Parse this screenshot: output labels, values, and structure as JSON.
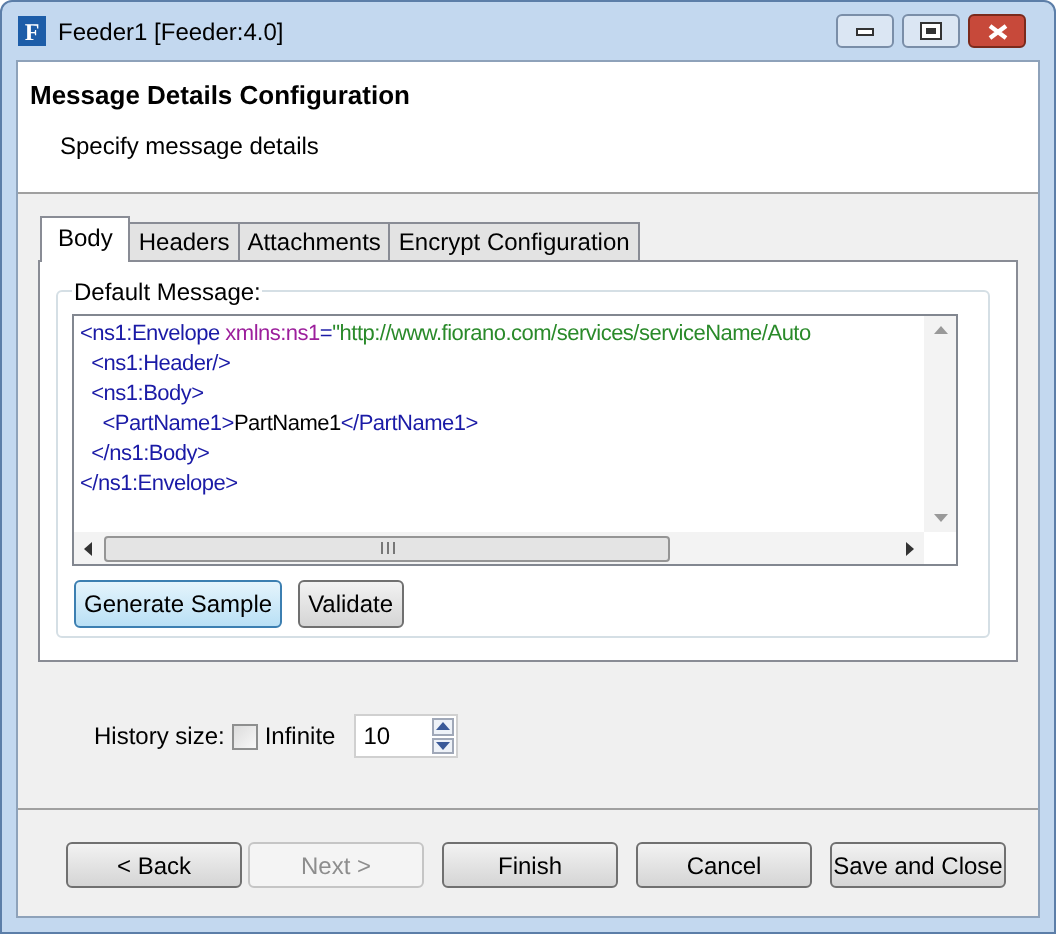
{
  "window": {
    "title": "Feeder1 [Feeder:4.0]",
    "app_icon": "F"
  },
  "header": {
    "title": "Message Details Configuration",
    "subtitle": "Specify message details"
  },
  "tabs": [
    {
      "label": "Body",
      "selected": true
    },
    {
      "label": "Headers",
      "selected": false
    },
    {
      "label": "Attachments",
      "selected": false
    },
    {
      "label": "Encrypt Configuration",
      "selected": false
    }
  ],
  "default_message": {
    "label": "Default Message:",
    "lines": [
      [
        {
          "kind": "tag",
          "text": "<ns1:Envelope"
        },
        {
          "kind": "attr",
          "text": " xmlns:ns1"
        },
        {
          "kind": "tag",
          "text": "="
        },
        {
          "kind": "value",
          "text": "\"http://www.fiorano.com/services/serviceName/Auto"
        }
      ],
      [
        {
          "kind": "tag",
          "text": "  <ns1:Header/>"
        }
      ],
      [
        {
          "kind": "tag",
          "text": "  <ns1:Body>"
        }
      ],
      [
        {
          "kind": "tag",
          "text": "    <PartName1>"
        },
        {
          "kind": "text",
          "text": "PartName1"
        },
        {
          "kind": "tag",
          "text": "</PartName1>"
        }
      ],
      [
        {
          "kind": "tag",
          "text": "  </ns1:Body>"
        }
      ],
      [
        {
          "kind": "tag",
          "text": "</ns1:Envelope>"
        }
      ]
    ],
    "buttons": [
      {
        "label": "Generate Sample",
        "focused": true
      },
      {
        "label": "Validate",
        "focused": false
      }
    ]
  },
  "history": {
    "label": "History size:",
    "infinite": {
      "label": "Infinite",
      "checked": false
    },
    "value": "10"
  },
  "buttons": [
    {
      "label": "< Back",
      "disabled": false
    },
    {
      "label": "Next >",
      "disabled": true
    },
    {
      "label": "Finish",
      "disabled": false
    },
    {
      "label": "Cancel",
      "disabled": false
    },
    {
      "label": "Save and Close",
      "disabled": false
    }
  ]
}
